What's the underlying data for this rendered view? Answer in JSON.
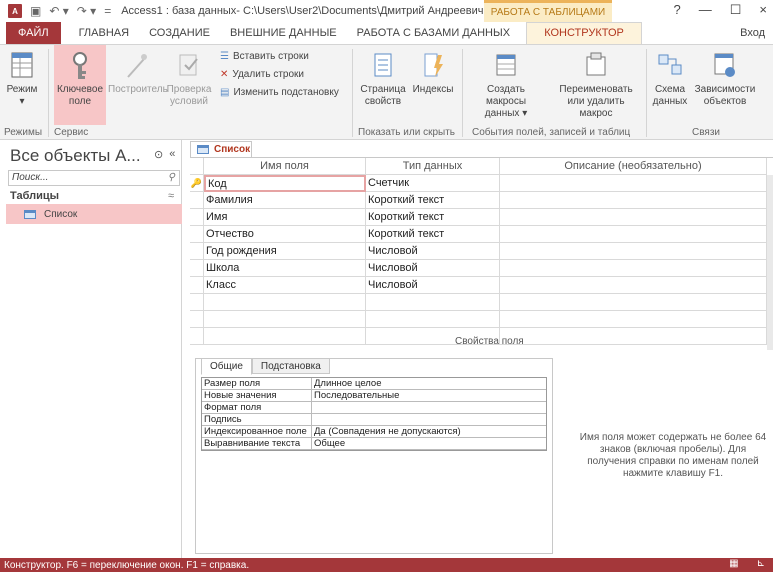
{
  "titlebar": {
    "app_icon": "A",
    "title": "Access1 : база данных- C:\\Users\\User2\\Documents\\Дмитрий Андреевич...",
    "context_tab_title": "РАБОТА С ТАБЛИЦАМИ",
    "help": "?",
    "minimize": "—",
    "restore": "☐",
    "close": "×"
  },
  "tabs": {
    "file": "ФАЙЛ",
    "home": "ГЛАВНАЯ",
    "create": "СОЗДАНИЕ",
    "external": "ВНЕШНИЕ ДАННЫЕ",
    "database": "РАБОТА С БАЗАМИ ДАННЫХ",
    "design": "КОНСТРУКТОР",
    "signin": "Вход"
  },
  "ribbon": {
    "view": "Режим",
    "view_arrow": "▾",
    "key_field_1": "Ключевое",
    "key_field_2": "поле",
    "builder": "Построитель",
    "check_1": "Проверка",
    "check_2": "условий",
    "insert_rows": "Вставить строки",
    "delete_rows": "Удалить строки",
    "modify_lookup": "Изменить подстановку",
    "property_sheet_1": "Страница",
    "property_sheet_2": "свойств",
    "indexes": "Индексы",
    "create_macros_1": "Создать макросы",
    "create_macros_2": "данных ▾",
    "rename_1": "Переименовать",
    "rename_2": "или удалить макрос",
    "schema_1": "Схема",
    "schema_2": "данных",
    "deps_1": "Зависимости",
    "deps_2": "объектов",
    "groups": {
      "views": "Режимы",
      "tools": "Сервис",
      "show_hide": "Показать или скрыть",
      "events": "События полей, записей и таблиц",
      "relations": "Связи"
    }
  },
  "nav": {
    "title": "Все объекты A...",
    "search_placeholder": "Поиск...",
    "section": "Таблицы",
    "section_chevron": "«",
    "items": [
      {
        "label": "Список"
      }
    ]
  },
  "doc": {
    "tab": "Список",
    "headers": [
      "Имя поля",
      "Тип данных",
      "Описание (необязательно)"
    ],
    "rows": [
      [
        "Код",
        "Счетчик",
        ""
      ],
      [
        "Фамилия",
        "Короткий текст",
        ""
      ],
      [
        "Имя",
        "Короткий текст",
        ""
      ],
      [
        "Отчество",
        "Короткий текст",
        ""
      ],
      [
        "Год рождения",
        "Числовой",
        ""
      ],
      [
        "Школа",
        "Числовой",
        ""
      ],
      [
        "Класс",
        "Числовой",
        ""
      ]
    ],
    "props_label": "Свойства поля",
    "prop_tabs": [
      "Общие",
      "Подстановка"
    ],
    "props": [
      [
        "Размер поля",
        "Длинное целое"
      ],
      [
        "Новые значения",
        "Последовательные"
      ],
      [
        "Формат поля",
        ""
      ],
      [
        "Подпись",
        ""
      ],
      [
        "Индексированное поле",
        "Да (Совпадения не допускаются)"
      ],
      [
        "Выравнивание текста",
        "Общее"
      ]
    ],
    "help": "Имя поля может содержать не более 64 знаков (включая пробелы). Для получения справки по именам полей нажмите клавишу F1."
  },
  "status": {
    "text": "Конструктор.  F6 = переключение окон.  F1 = справка."
  }
}
